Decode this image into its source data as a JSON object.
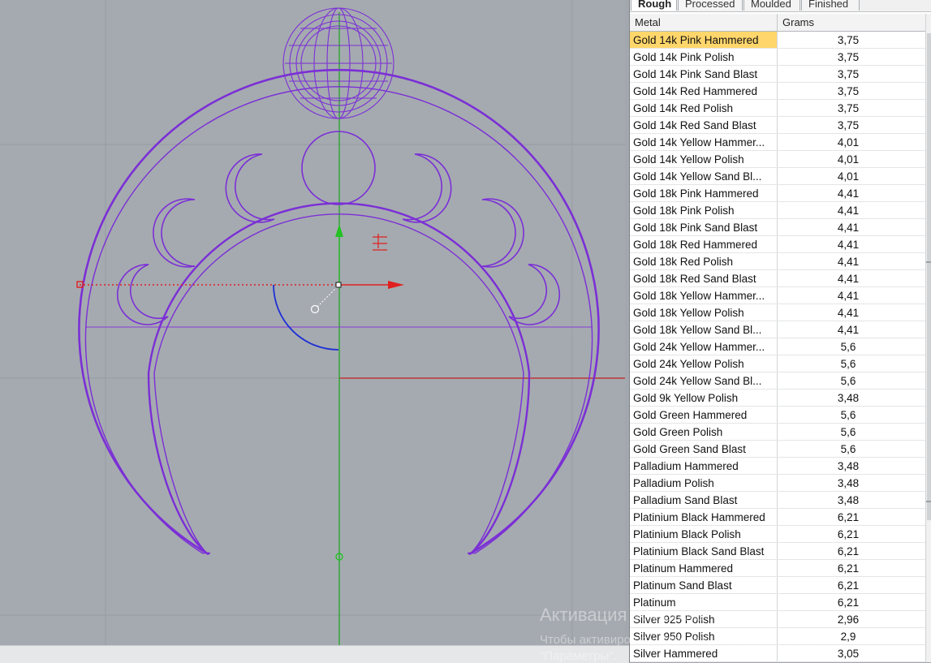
{
  "tabs": [
    {
      "label": "Rough",
      "active": true
    },
    {
      "label": "Processed",
      "active": false
    },
    {
      "label": "Moulded",
      "active": false
    },
    {
      "label": "Finished",
      "active": false
    }
  ],
  "table": {
    "columns": [
      "Metal",
      "Grams"
    ],
    "selected_index": 0,
    "rows": [
      [
        "Gold 14k Pink Hammered",
        "3,75"
      ],
      [
        "Gold 14k Pink Polish",
        "3,75"
      ],
      [
        "Gold 14k Pink Sand Blast",
        "3,75"
      ],
      [
        "Gold 14k Red Hammered",
        "3,75"
      ],
      [
        "Gold 14k Red Polish",
        "3,75"
      ],
      [
        "Gold 14k Red Sand Blast",
        "3,75"
      ],
      [
        "Gold 14k Yellow Hammer...",
        "4,01"
      ],
      [
        "Gold 14k Yellow Polish",
        "4,01"
      ],
      [
        "Gold 14k Yellow Sand Bl...",
        "4,01"
      ],
      [
        "Gold 18k Pink Hammered",
        "4,41"
      ],
      [
        "Gold 18k Pink Polish",
        "4,41"
      ],
      [
        "Gold 18k Pink Sand Blast",
        "4,41"
      ],
      [
        "Gold 18k Red Hammered",
        "4,41"
      ],
      [
        "Gold 18k Red Polish",
        "4,41"
      ],
      [
        "Gold 18k Red Sand Blast",
        "4,41"
      ],
      [
        "Gold 18k Yellow Hammer...",
        "4,41"
      ],
      [
        "Gold 18k Yellow Polish",
        "4,41"
      ],
      [
        "Gold 18k Yellow Sand Bl...",
        "4,41"
      ],
      [
        "Gold 24k Yellow Hammer...",
        "5,6"
      ],
      [
        "Gold 24k Yellow Polish",
        "5,6"
      ],
      [
        "Gold 24k Yellow Sand Bl...",
        "5,6"
      ],
      [
        "Gold 9k Yellow Polish",
        "3,48"
      ],
      [
        "Gold Green Hammered",
        "5,6"
      ],
      [
        "Gold Green Polish",
        "5,6"
      ],
      [
        "Gold Green Sand Blast",
        "5,6"
      ],
      [
        "Palladium Hammered",
        "3,48"
      ],
      [
        "Palladium Polish",
        "3,48"
      ],
      [
        "Palladium Sand Blast",
        "3,48"
      ],
      [
        "Platinium Black Hammered",
        "6,21"
      ],
      [
        "Platinium Black Polish",
        "6,21"
      ],
      [
        "Platinium Black Sand Blast",
        "6,21"
      ],
      [
        "Platinum Hammered",
        "6,21"
      ],
      [
        "Platinum Sand Blast",
        "6,21"
      ],
      [
        "Platinum",
        "6,21"
      ],
      [
        "Silver 925 Polish",
        "2,96"
      ],
      [
        "Silver 950 Polish",
        "2,9"
      ],
      [
        "Silver Hammered",
        "3,05"
      ]
    ]
  },
  "watermark": {
    "line1": "Активация Windows",
    "line2": "Чтобы активировать Windows, перейдите в раздел",
    "line3": "\"Параметры\"."
  },
  "colors": {
    "viewport_bg": "#a5aab0",
    "curve": "#7b2fd6",
    "x_axis": "#c41e1e",
    "y_axis": "#17a41d",
    "gumball_x": "#e02020",
    "gumball_y": "#22c322",
    "gumball_arc": "#1d2fd6",
    "selection": "#ffd66b"
  }
}
